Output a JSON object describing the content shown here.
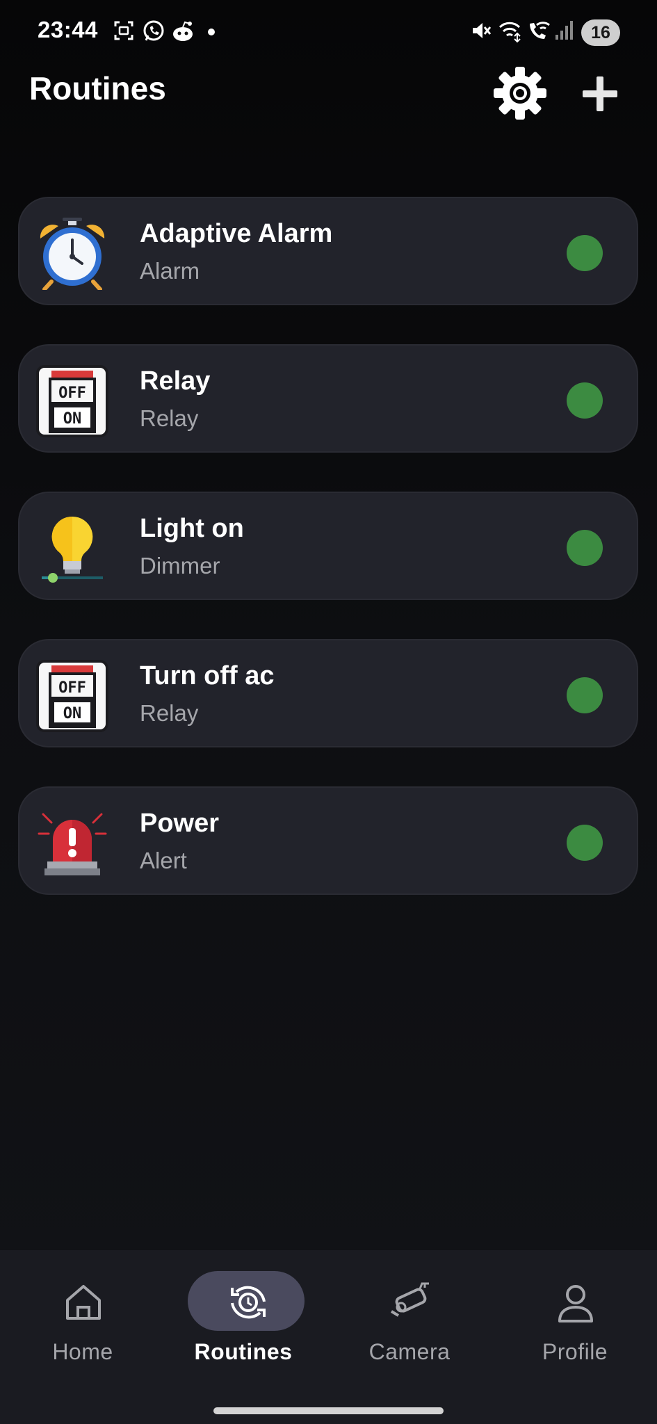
{
  "status_bar": {
    "time": "23:44",
    "battery": "16",
    "icons": [
      "screenshot-icon",
      "whatsapp-icon",
      "reddit-icon",
      "dot-icon",
      "mute-icon",
      "wifi-icon",
      "wifi-call-icon",
      "signal-icon"
    ]
  },
  "header": {
    "title": "Routines",
    "settings_icon": "gear-icon",
    "add_icon": "plus-icon"
  },
  "routines": [
    {
      "name": "Adaptive Alarm",
      "type": "Alarm",
      "icon": "alarm-clock-icon",
      "enabled": true
    },
    {
      "name": "Relay",
      "type": "Relay",
      "icon": "relay-switch-icon",
      "enabled": true
    },
    {
      "name": "Light on",
      "type": "Dimmer",
      "icon": "light-bulb-dimmer-icon",
      "enabled": true
    },
    {
      "name": "Turn off ac",
      "type": "Relay",
      "icon": "relay-switch-icon",
      "enabled": true
    },
    {
      "name": "Power",
      "type": "Alert",
      "icon": "siren-alert-icon",
      "enabled": true
    }
  ],
  "relay_icon_text": {
    "off": "OFF",
    "on": "ON"
  },
  "nav": {
    "items": [
      {
        "label": "Home",
        "icon": "home-icon",
        "active": false
      },
      {
        "label": "Routines",
        "icon": "routines-icon",
        "active": true
      },
      {
        "label": "Camera",
        "icon": "camera-icon",
        "active": false
      },
      {
        "label": "Profile",
        "icon": "profile-icon",
        "active": false
      }
    ]
  },
  "colors": {
    "background": "#0d0e11",
    "card": "#22232b",
    "status_dot": "#3c8b41",
    "subtitle": "#a5a6ab",
    "nav_active_pill": "#4a4a5e"
  }
}
